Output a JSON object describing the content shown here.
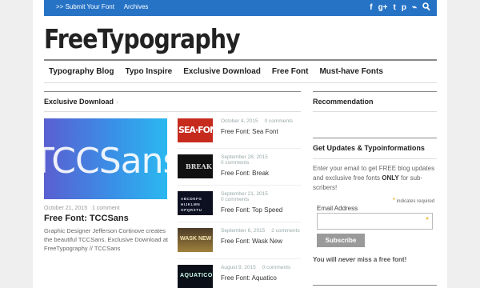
{
  "topbar": {
    "submit_label": ">> Submit Your Font",
    "archives_label": "Archives",
    "icons": [
      "facebook-icon",
      "google-plus-icon",
      "twitter-icon",
      "pinterest-icon",
      "rss-icon",
      "search-icon"
    ],
    "color": "#2673c6"
  },
  "logo": "FreeTypography",
  "nav": [
    "Typography Blog",
    "Typo Inspire",
    "Exclusive Download",
    "Free Font",
    "Must-have Fonts"
  ],
  "main": {
    "section_title": "Exclusive Download",
    "featured": {
      "image_text": "TCCSans",
      "date": "October 21, 2015",
      "comments": "1 comment",
      "title": "Free Font: TCCSans",
      "excerpt": "Graphic Designer Jefferson Cortinove creates the beautiful TCCSans. Exclusive Download at FreeTypography // TCCSans"
    },
    "posts": [
      {
        "date": "October 4, 2015",
        "comments": "0 comments",
        "title": "Free Font: Sea Font",
        "thumb_text": "SEA·FONT"
      },
      {
        "date": "September 28, 2015",
        "comments": "0 comments",
        "title": "Free Font: Break",
        "thumb_text": "BREAK"
      },
      {
        "date": "September 21, 2015",
        "comments": "0 comments",
        "title": "Free Font: Top Speed",
        "thumb_text": "ABCDEFG\nHIJKLMN\nOPQRSTU"
      },
      {
        "date": "September 6, 2015",
        "comments": "2 comments",
        "title": "Free Font: Wask New",
        "thumb_text": "WASK NEW"
      },
      {
        "date": "August 9, 2015",
        "comments": "0 comments",
        "title": "Free Font: Aquatico",
        "thumb_text": "AQUATICO"
      }
    ]
  },
  "sidebar": {
    "recommendation_title": "Recommendation",
    "updates_title": "Get Updates & Typoinformations",
    "text_before": "Enter your email to get FREE blog updates and exclusive free fonts ",
    "text_bold": "ONLY",
    "text_after": " for sub-scribers!",
    "required_note": "indicates required",
    "email_label": "Email Address",
    "email_value": "",
    "subscribe_label": "Subscribe",
    "never_before": "You will ",
    "never_italic": "never",
    "never_after": " miss a free font!"
  }
}
